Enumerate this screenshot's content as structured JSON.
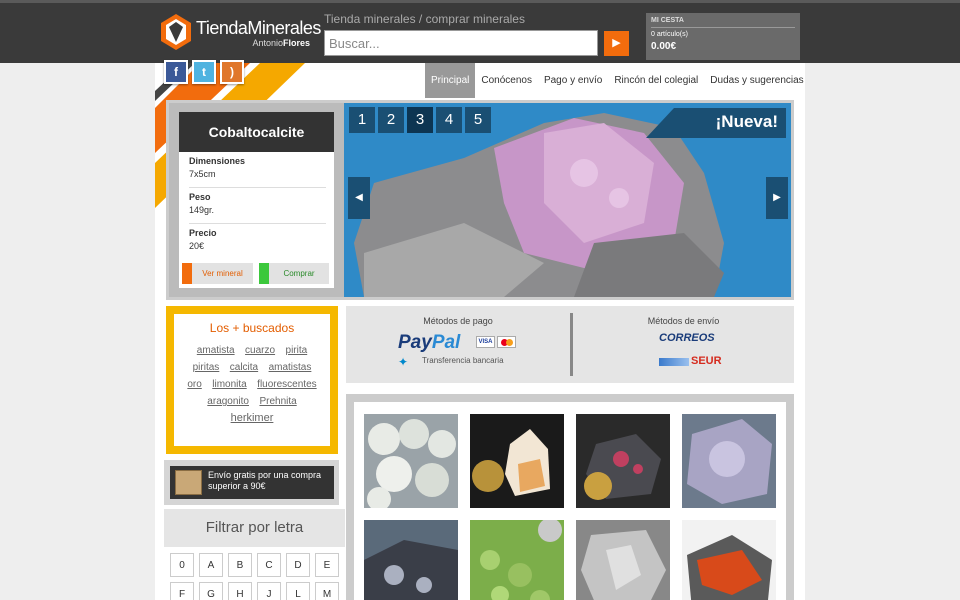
{
  "header": {
    "logo_title": "TiendaMinerales",
    "logo_sub_first": "Antonio",
    "logo_sub_last": "Flores",
    "tagline": "Tienda minerales / comprar minerales",
    "search_placeholder": "Buscar...",
    "search_button_icon": "play-arrow-icon"
  },
  "cart": {
    "title": "MI CESTA",
    "items": "0 artículo(s)",
    "total": "0.00€"
  },
  "social": [
    {
      "icon": "facebook-icon",
      "glyph": "f"
    },
    {
      "icon": "twitter-icon",
      "glyph": "t"
    },
    {
      "icon": "rss-icon",
      "glyph": ")"
    }
  ],
  "nav": [
    "Principal",
    "Conócenos",
    "Pago y envío",
    "Rincón del colegial",
    "Dudas y sugerencias"
  ],
  "nav_active": 0,
  "featured": {
    "name": "Cobaltocalcite",
    "fields": [
      {
        "label": "Dimensiones",
        "value": "7x5cm"
      },
      {
        "label": "Peso",
        "value": "149gr."
      },
      {
        "label": "Precio",
        "value": "20€"
      }
    ],
    "view_button": "Ver mineral",
    "buy_button": "Comprar",
    "badge": "¡Nueva!",
    "slides": [
      "1",
      "2",
      "3",
      "4",
      "5"
    ],
    "active_slide": 2
  },
  "popular": {
    "title": "Los + buscados",
    "tags": [
      "amatista",
      "cuarzo",
      "pirita",
      "piritas",
      "calcita",
      "amatistas",
      "oro",
      "limonita",
      "fluorescentes",
      "aragonito",
      "Prehnita",
      "herkimer"
    ]
  },
  "free_shipping": "Envío gratis por una compra superior a 90€",
  "filter": {
    "title": "Filtrar por letra",
    "letters": [
      "0",
      "A",
      "B",
      "C",
      "D",
      "E",
      "F",
      "G",
      "H",
      "J",
      "L",
      "M"
    ]
  },
  "payment": {
    "title": "Métodos de pago",
    "paypal_part1": "Pay",
    "paypal_part2": "Pal",
    "visa": "VISA",
    "transfer": "Transferencia bancaria"
  },
  "delivery": {
    "title": "Métodos de envío",
    "correos": "CORREOS",
    "seur": "SEUR"
  },
  "colors": {
    "accent_orange": "#f26c0d",
    "accent_yellow": "#f5b800",
    "slider_blue": "#2f8ac7",
    "header_dark": "#3a3a3a"
  }
}
